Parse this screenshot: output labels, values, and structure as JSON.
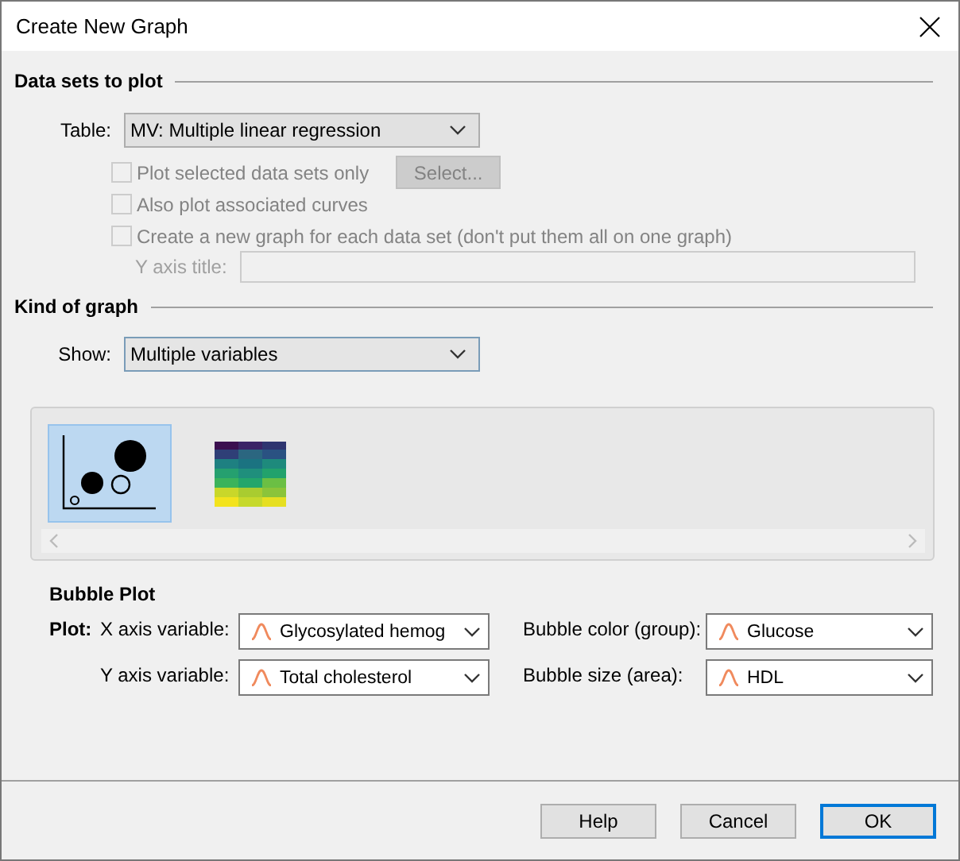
{
  "window": {
    "title": "Create New Graph"
  },
  "data_sets": {
    "heading": "Data sets to plot",
    "table_label": "Table:",
    "table_value": "MV: Multiple linear regression",
    "options": [
      {
        "label": "Plot selected data sets only",
        "checked": false,
        "disabled": true
      },
      {
        "label": "Also plot associated curves",
        "checked": false,
        "disabled": true
      },
      {
        "label": "Create a new graph for each data set (don't put them all on one graph)",
        "checked": false,
        "disabled": true
      }
    ],
    "select_button": {
      "label": "Select...",
      "disabled": true
    },
    "y_axis_title": {
      "label": "Y axis title:",
      "disabled": true
    }
  },
  "kind_of_graph": {
    "heading": "Kind of graph",
    "show_label": "Show:",
    "show_value": "Multiple variables",
    "gallery": [
      {
        "kind": "bubble",
        "selected": true
      },
      {
        "kind": "heatmap",
        "selected": false
      }
    ]
  },
  "bubble_plot": {
    "heading": "Bubble Plot",
    "plot_label": "Plot:",
    "fields": [
      {
        "label": "X axis variable:",
        "value": "Glycosylated hemog"
      },
      {
        "label": "Y axis variable:",
        "value": "Total cholesterol"
      },
      {
        "label": "Bubble color (group):",
        "value": "Glucose"
      },
      {
        "label": "Bubble size (area):",
        "value": "HDL"
      }
    ]
  },
  "buttons": [
    {
      "label": "Help",
      "default": false
    },
    {
      "label": "Cancel",
      "default": false
    },
    {
      "label": "OK",
      "default": true
    }
  ]
}
